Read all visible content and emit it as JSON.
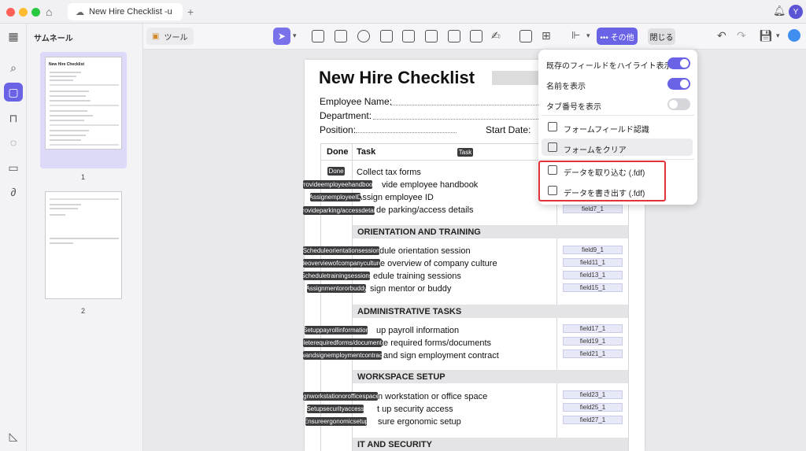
{
  "window": {
    "tab_title": "New Hire Checklist -u",
    "avatar_letter": "Y"
  },
  "sidebar": {
    "panel_title": "サムネール",
    "page_numbers": [
      "1",
      "2"
    ],
    "thumb_title": "New Hire Checklist"
  },
  "toolbar": {
    "tools_label": "ツール",
    "more_label": "••• その他",
    "close_label": "閉じる"
  },
  "document": {
    "title": "New Hire Checklist",
    "employee_name_label": "Employee Name:",
    "department_label": "Department:",
    "position_label": "Position:",
    "start_date_label": "Start Date:",
    "col_done": "Done",
    "col_task": "Task",
    "task_tag": "Task",
    "done_tag": "Done",
    "sections": [
      {
        "name": "ORIENTATION AND TRAINING"
      },
      {
        "name": "ADMINISTRATIVE TASKS"
      },
      {
        "name": "WORKSPACE SETUP"
      },
      {
        "name": "IT AND SECURITY"
      }
    ],
    "tasks": [
      {
        "text": "Collect tax forms",
        "tag": "",
        "field": ""
      },
      {
        "text": "vide employee handbook",
        "tag": "Provideemployeehandbook",
        "field": ""
      },
      {
        "text": "Assign employee ID",
        "tag": "AssignemployeeID",
        "field": ""
      },
      {
        "text": "de parking/access details",
        "tag": "Provideparking/accessdetails",
        "field": "field7_1"
      },
      {
        "text": "dule orientation session",
        "tag": "Scheduleorientationsession",
        "field": "field9_1"
      },
      {
        "text": "e overview of company culture",
        "tag": "deoverviewofcompanyculture",
        "field": "field11_1"
      },
      {
        "text": "edule training sessions",
        "tag": "Scheduletrainingsessions",
        "field": "field13_1"
      },
      {
        "text": "sign mentor or buddy",
        "tag": "Assignmentororbuddy",
        "field": "field15_1"
      },
      {
        "text": "up payroll information",
        "tag": "Setuppayrollinformation",
        "field": "field17_1"
      },
      {
        "text": "te required forms/documents",
        "tag": "pleterequiredforms/documents",
        "field": "field19_1"
      },
      {
        "text": "and sign employment contract",
        "tag": "wandsignemploymentcontract",
        "field": "field21_1"
      },
      {
        "text": "n workstation or office space",
        "tag": "ignworkstationorofficespace",
        "field": "field23_1"
      },
      {
        "text": "t up security access",
        "tag": "Setupsecurityaccess",
        "field": "field25_1"
      },
      {
        "text": "sure ergonomic setup",
        "tag": "Ensureergonomicsetup",
        "field": "field27_1"
      }
    ]
  },
  "menu": {
    "highlight_fields": "既存のフィールドをハイライト表示",
    "show_names": "名前を表示",
    "show_tab_order": "タブ番号を表示",
    "recognize_fields": "フォームフィールド認識",
    "clear_form": "フォームをクリア",
    "import_data": "データを取り込む (.fdf)",
    "export_data": "データを書き出す (.fdf)",
    "toggles": {
      "highlight_fields": true,
      "show_names": true,
      "show_tab_order": false
    }
  },
  "colors": {
    "accent": "#6a63e6",
    "toggle_off": "#d6d6da",
    "highlight_box": "#e0343a"
  },
  "icons": [
    "home-icon",
    "cloud-icon",
    "plus-icon",
    "bell-icon",
    "grid-icon",
    "search-icon",
    "page-icon",
    "bookmark-icon",
    "comment-icon",
    "attachment-icon",
    "paperclip-icon",
    "layers-icon",
    "undo-icon",
    "redo-icon",
    "save-icon",
    "app-logo-icon"
  ]
}
